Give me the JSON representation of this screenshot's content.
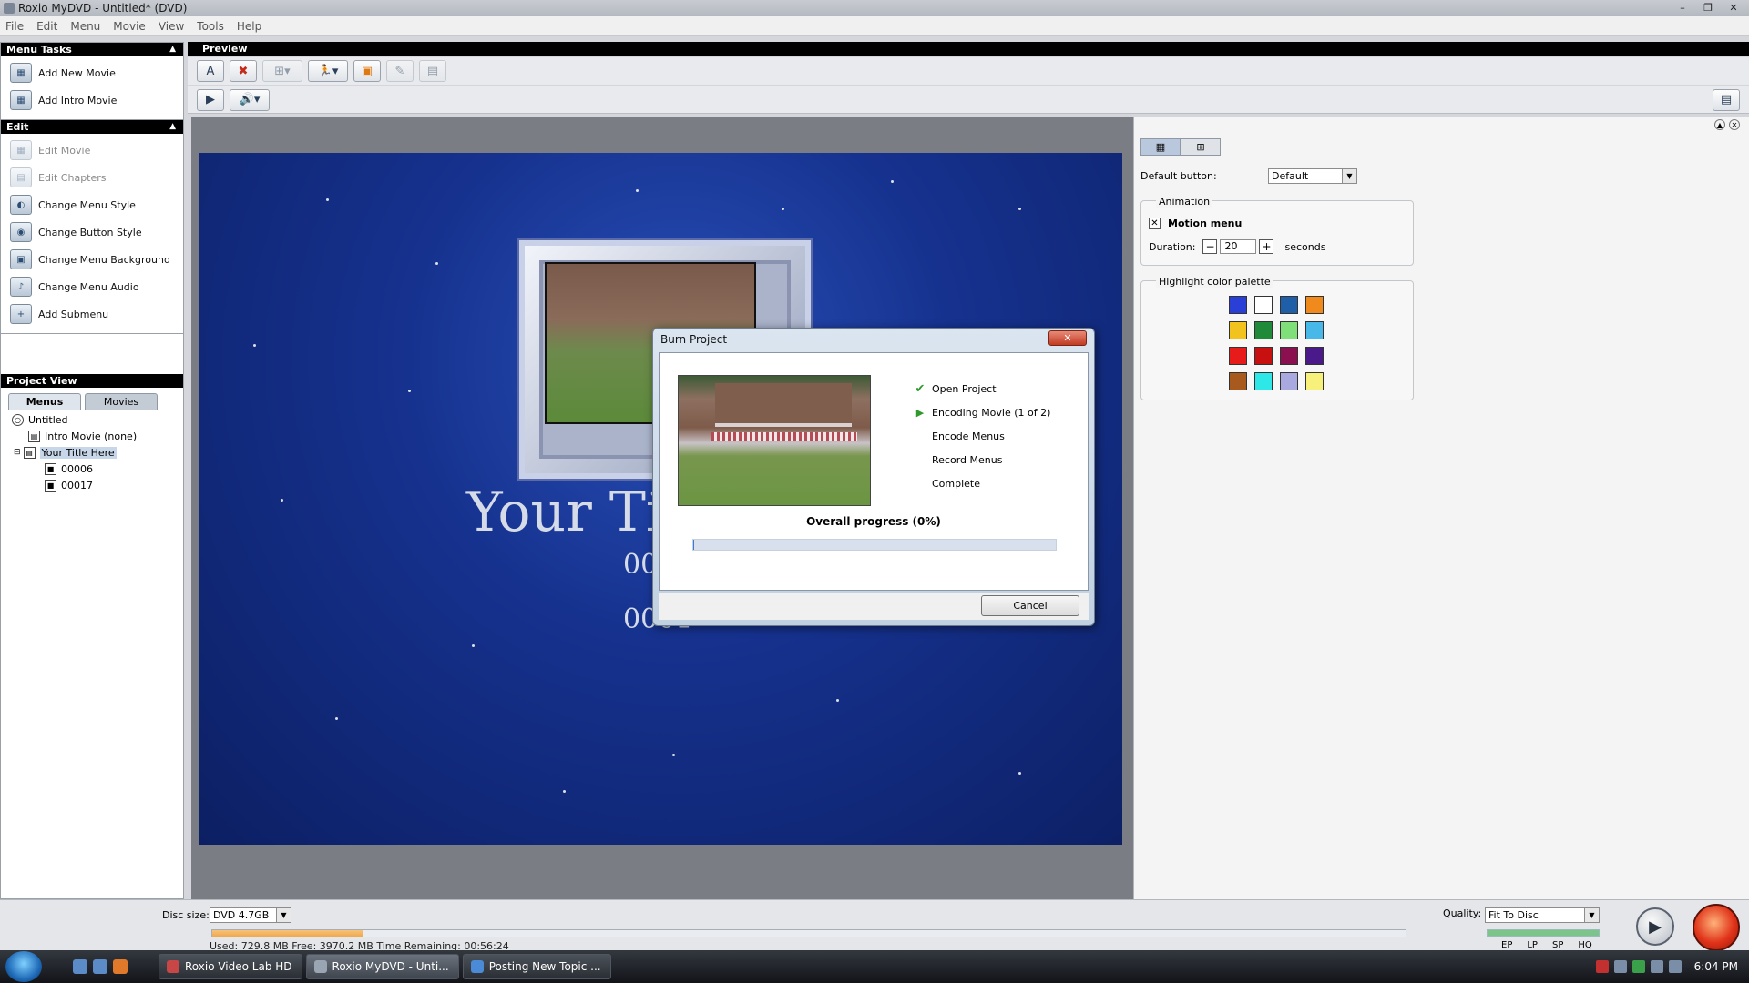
{
  "window": {
    "title": "Roxio MyDVD - Untitled* (DVD)"
  },
  "menu": [
    "File",
    "Edit",
    "Menu",
    "Movie",
    "View",
    "Tools",
    "Help"
  ],
  "menu_tasks": {
    "header": "Menu Tasks",
    "items": [
      "Add New Movie",
      "Add Intro Movie"
    ]
  },
  "edit_tasks": {
    "header": "Edit",
    "items": [
      {
        "label": "Edit Movie",
        "enabled": false
      },
      {
        "label": "Edit Chapters",
        "enabled": false
      },
      {
        "label": "Change Menu Style",
        "enabled": true
      },
      {
        "label": "Change Button Style",
        "enabled": true
      },
      {
        "label": "Change Menu Background",
        "enabled": true
      },
      {
        "label": "Change Menu Audio",
        "enabled": true
      },
      {
        "label": "Add Submenu",
        "enabled": true
      }
    ]
  },
  "project_view": {
    "header": "Project View",
    "tabs": [
      "Menus",
      "Movies"
    ],
    "tree": {
      "root": "Untitled",
      "intro": "Intro Movie (none)",
      "menu": "Your Title Here",
      "chapters": [
        "00006",
        "00017"
      ]
    }
  },
  "preview": {
    "header": "Preview",
    "title_text": "Your Ti",
    "chapter_1": "00",
    "chapter_2": "0001"
  },
  "properties": {
    "default_button_label": "Default button:",
    "default_button_value": "Default",
    "animation_title": "Animation",
    "motion_menu_label": "Motion menu",
    "motion_menu_checked": true,
    "duration_label": "Duration:",
    "duration_value": "20",
    "duration_unit": "seconds",
    "palette_title": "Highlight color palette",
    "palette": [
      "#2a3fd6",
      "#ffffff",
      "#1f5fa8",
      "#f08a1c",
      "#f2c21e",
      "#1f8a3a",
      "#7fe07a",
      "#48b8e8",
      "#e81b1b",
      "#c81010",
      "#8a1050",
      "#4a1a8a",
      "#a85a1e",
      "#2ee8e8",
      "#a9a9e0",
      "#f7f07a"
    ]
  },
  "dialog": {
    "title": "Burn Project",
    "steps": [
      {
        "label": "Open Project",
        "state": "done"
      },
      {
        "label": "Encoding Movie (1 of 2)",
        "state": "active"
      },
      {
        "label": "Encode Menus",
        "state": "pending"
      },
      {
        "label": "Record Menus",
        "state": "pending"
      },
      {
        "label": "Complete",
        "state": "pending"
      }
    ],
    "overall_label": "Overall progress (0%)",
    "progress_fraction": 0.0,
    "cancel_label": "Cancel"
  },
  "status": {
    "disc_size_label": "Disc size:",
    "disc_size_value": "DVD 4.7GB",
    "disc_used_fraction": 0.127,
    "disc_info": "Used: 729.8 MB  Free: 3970.2 MB  Time Remaining: 00:56:24",
    "quality_label": "Quality:",
    "quality_value": "Fit To Disc",
    "quality_levels": [
      "EP",
      "LP",
      "SP",
      "HQ"
    ]
  },
  "taskbar": {
    "items": [
      "Roxio Video Lab HD",
      "Roxio MyDVD - Unti...",
      "Posting New Topic ..."
    ],
    "clock": "6:04 PM"
  }
}
